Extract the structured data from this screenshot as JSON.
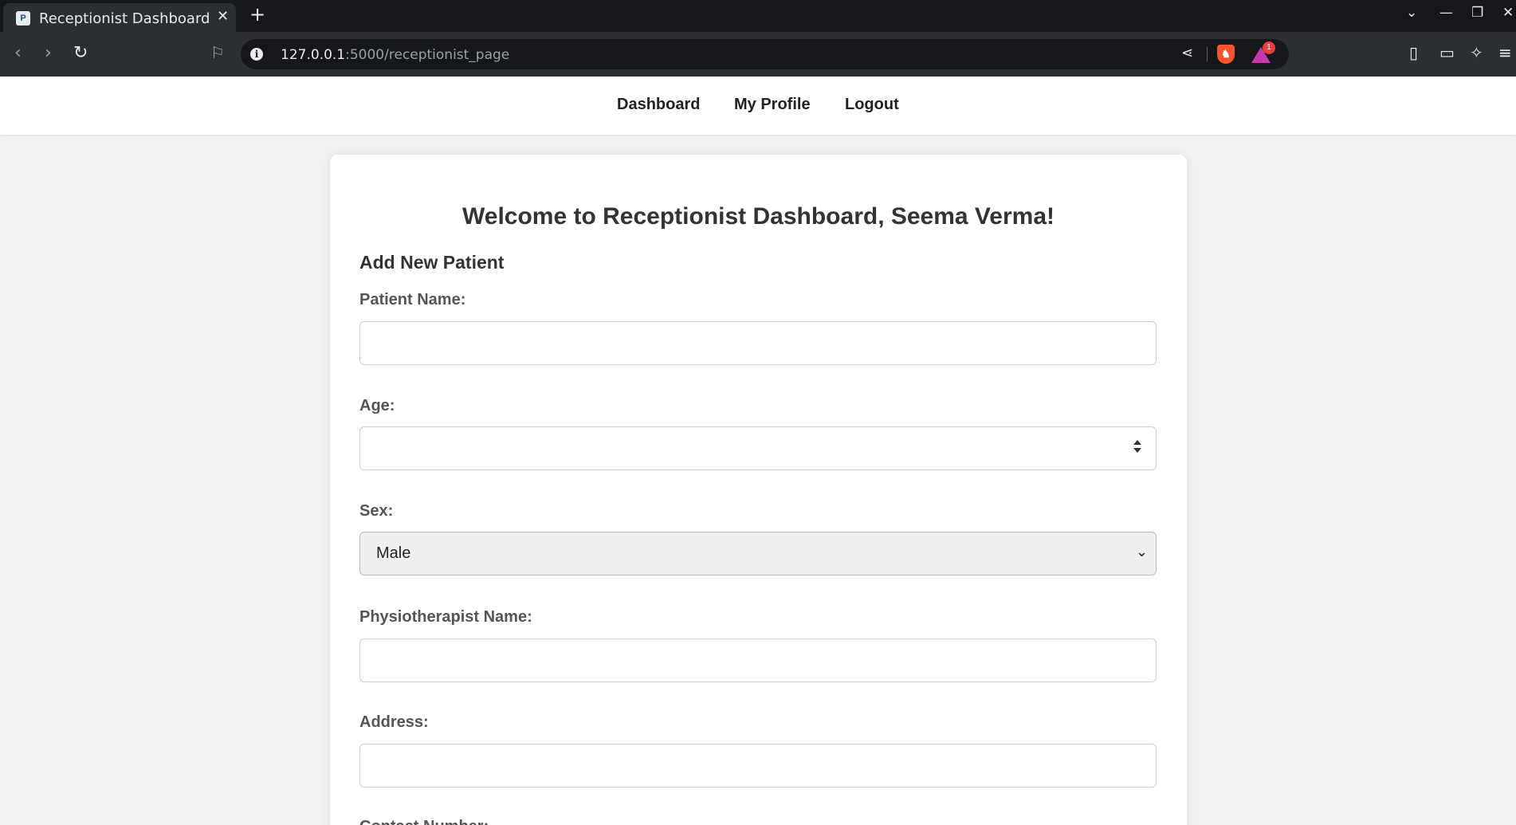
{
  "browser": {
    "tab_title": "Receptionist Dashboard",
    "tab_close": "✕",
    "new_tab": "+",
    "url_host": "127.0.0.1",
    "url_path": ":5000/receptionist_page",
    "rewards_badge": "1"
  },
  "nav": {
    "dashboard": "Dashboard",
    "profile": "My Profile",
    "logout": "Logout"
  },
  "page": {
    "welcome": "Welcome to Receptionist Dashboard, Seema Verma!",
    "section_title": "Add New Patient",
    "labels": {
      "patient_name": "Patient Name:",
      "age": "Age:",
      "sex": "Sex:",
      "physiotherapist": "Physiotherapist Name:",
      "address": "Address:",
      "contact": "Contact Number:"
    },
    "values": {
      "patient_name": "",
      "age": "",
      "sex": "Male",
      "physiotherapist": "",
      "address": ""
    }
  },
  "icons": {
    "back": "back-arrow-icon",
    "forward": "forward-arrow-icon",
    "reload": "reload-icon",
    "bookmark": "bookmark-icon",
    "share": "share-icon",
    "brave": "brave-shield-icon",
    "rewards": "brave-rewards-icon",
    "sidebar": "sidebar-icon",
    "wallet": "wallet-icon",
    "leo": "leo-ai-icon",
    "menu": "menu-icon"
  }
}
